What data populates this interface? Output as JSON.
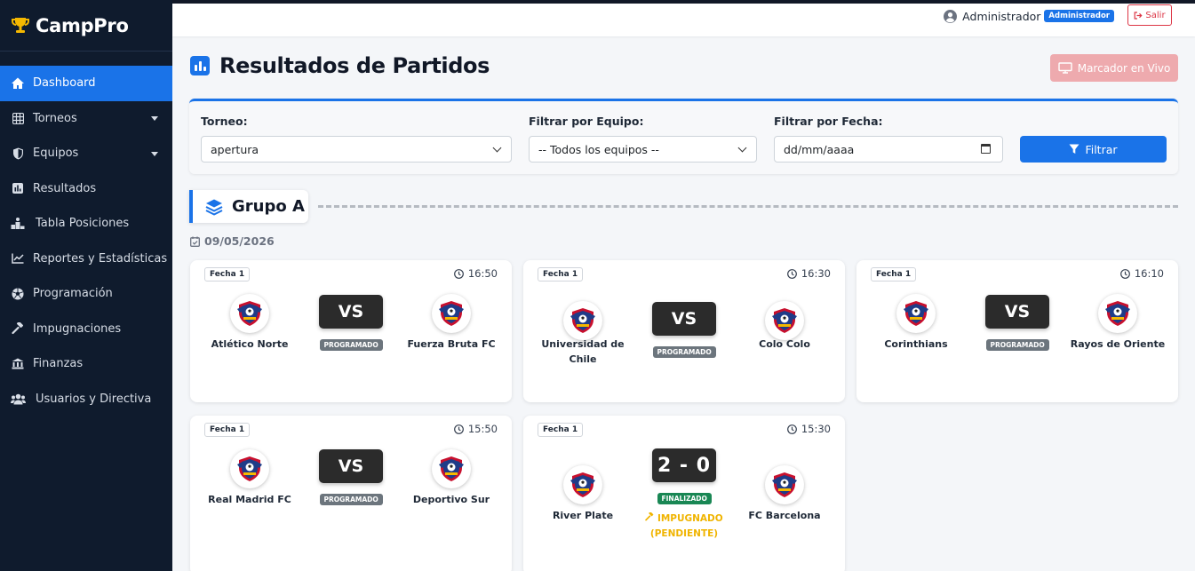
{
  "app": {
    "name": "CampPro"
  },
  "sidebar": {
    "items": [
      {
        "label": "Dashboard",
        "icon": "home-icon",
        "active": true
      },
      {
        "label": "Torneos",
        "icon": "table-icon",
        "submenu": true
      },
      {
        "label": "Equipos",
        "icon": "shield-icon",
        "submenu": true
      },
      {
        "label": "Resultados",
        "icon": "bar-chart-icon"
      },
      {
        "label": "Tabla Posiciones",
        "icon": "podium-icon"
      },
      {
        "label": "Reportes y Estadísticas",
        "icon": "line-chart-icon"
      },
      {
        "label": "Programación",
        "icon": "soccer-ball-icon"
      },
      {
        "label": "Impugnaciones",
        "icon": "gavel-icon"
      },
      {
        "label": "Finanzas",
        "icon": "building-icon"
      },
      {
        "label": "Usuarios y Directiva",
        "icon": "users-icon"
      }
    ]
  },
  "topbar": {
    "user_name": "Administrador",
    "role": "Administrador",
    "logout": "Salir"
  },
  "page": {
    "title": "Resultados de Partidos",
    "live_button": "Marcador en Vivo"
  },
  "filters": {
    "tournament_label": "Torneo:",
    "tournament_value": "apertura",
    "team_label": "Filtrar por Equipo:",
    "team_value": "-- Todos los equipos --",
    "date_label": "Filtrar por Fecha:",
    "date_placeholder": "dd/mm/aaaa",
    "button": "Filtrar"
  },
  "group": {
    "title": "Grupo A",
    "date": "09/05/2026"
  },
  "matches": [
    {
      "fecha": "Fecha 1",
      "time": "16:50",
      "home": "Atlético Norte",
      "away": "Fuerza Bruta FC",
      "score": "VS",
      "status": "PROGRAMADO"
    },
    {
      "fecha": "Fecha 1",
      "time": "16:30",
      "home": "Universidad de Chile",
      "away": "Colo Colo",
      "score": "VS",
      "status": "PROGRAMADO"
    },
    {
      "fecha": "Fecha 1",
      "time": "16:10",
      "home": "Corinthians",
      "away": "Rayos de Oriente",
      "score": "VS",
      "status": "PROGRAMADO"
    },
    {
      "fecha": "Fecha 1",
      "time": "15:50",
      "home": "Real Madrid FC",
      "away": "Deportivo Sur",
      "score": "VS",
      "status": "PROGRAMADO"
    },
    {
      "fecha": "Fecha 1",
      "time": "15:30",
      "home": "River Plate",
      "away": "FC Barcelona",
      "score": "2 - 0",
      "status": "FINALIZADO",
      "protest": "IMPUGNADO (PENDIENTE)"
    }
  ],
  "colors": {
    "primary": "#1a73e8",
    "sidebar": "#0f1b2d",
    "danger": "#dc3545",
    "success": "#198754",
    "warning": "#f0b400"
  }
}
